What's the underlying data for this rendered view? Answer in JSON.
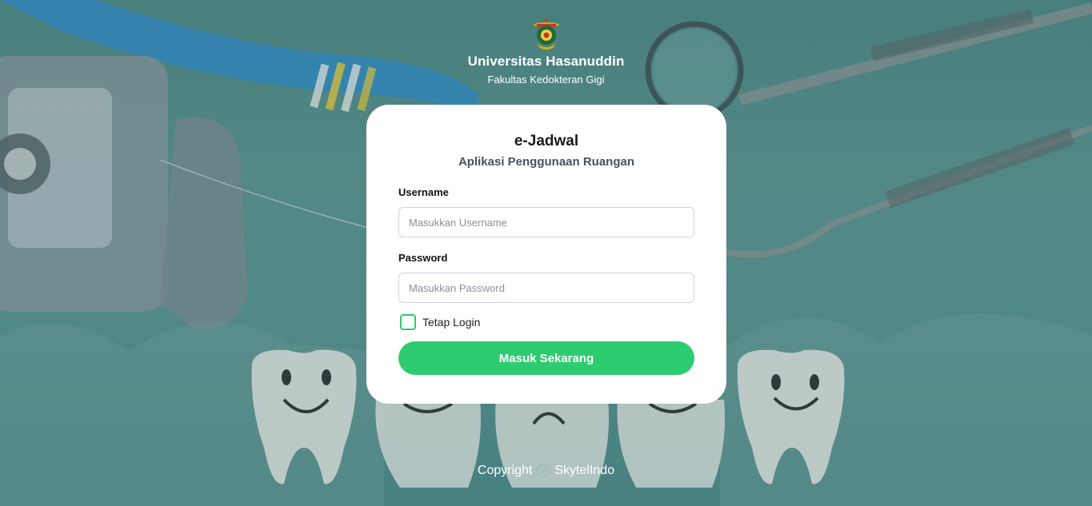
{
  "header": {
    "logo_icon": "university-crest-icon",
    "university": "Universitas Hasanuddin",
    "faculty": "Fakultas Kedokteran Gigi"
  },
  "card": {
    "title": "e-Jadwal",
    "subtitle": "Aplikasi Penggunaan Ruangan",
    "username_label": "Username",
    "username_placeholder": "Masukkan Username",
    "username_value": "",
    "password_label": "Password",
    "password_placeholder": "Masukkan Password",
    "password_value": "",
    "remember_label": "Tetap Login",
    "remember_checked": false,
    "submit_label": "Masuk Sekarang"
  },
  "footer": {
    "prefix": "Copyright",
    "icon": "copyright-icon",
    "owner": "SkytelIndo"
  },
  "colors": {
    "accent": "#2ecc71",
    "background": "#5a9694",
    "card": "#ffffff"
  }
}
